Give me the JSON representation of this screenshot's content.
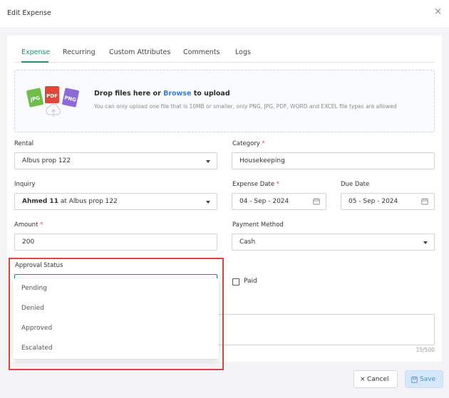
{
  "dialog": {
    "title": "Edit Expense",
    "close_glyph": "×"
  },
  "tabs": [
    {
      "label": "Expense",
      "active": true
    },
    {
      "label": "Recurring"
    },
    {
      "label": "Custom Attributes"
    },
    {
      "label": "Comments"
    },
    {
      "label": "Logs"
    }
  ],
  "upload": {
    "title_prefix": "Drop files here or ",
    "browse": "Browse",
    "title_suffix": " to upload",
    "subtitle": "You can only upload one file that is 10MB or smaller, only PNG, JPG, PDF, WORD and EXCEL file types are allowed",
    "icon_labels": {
      "jpg": "JPG",
      "pdf": "PDF",
      "png": "PNG"
    }
  },
  "form": {
    "rental": {
      "label": "Rental",
      "value": "Albus prop 122"
    },
    "category": {
      "label": "Category",
      "required": "*",
      "value": "Housekeeping"
    },
    "inquiry": {
      "label": "Inquiry",
      "value_bold": "Ahmed 11",
      "value_rest": " at Albus prop 122"
    },
    "expense_date": {
      "label": "Expense Date",
      "required": "*",
      "value": "04 - Sep - 2024"
    },
    "due_date": {
      "label": "Due Date",
      "value": "05 - Sep - 2024"
    },
    "amount": {
      "label": "Amount",
      "required": "*",
      "value": "200"
    },
    "payment_method": {
      "label": "Payment Method",
      "value": "Cash"
    },
    "approval_status": {
      "label": "Approval Status",
      "value": ""
    },
    "paid": {
      "label": "Paid",
      "checked": false
    },
    "notes_counter": "15/500"
  },
  "approval_options": [
    "Pending",
    "Denied",
    "Approved",
    "Escalated"
  ],
  "footer": {
    "cancel_label": "Cancel",
    "cancel_glyph": "×",
    "save_label": "Save"
  },
  "colors": {
    "accent": "#1f8f74",
    "link": "#3a7bd5",
    "required": "#e04b4b",
    "highlight": "#d9443c",
    "save_bg": "#d5e7f8"
  }
}
